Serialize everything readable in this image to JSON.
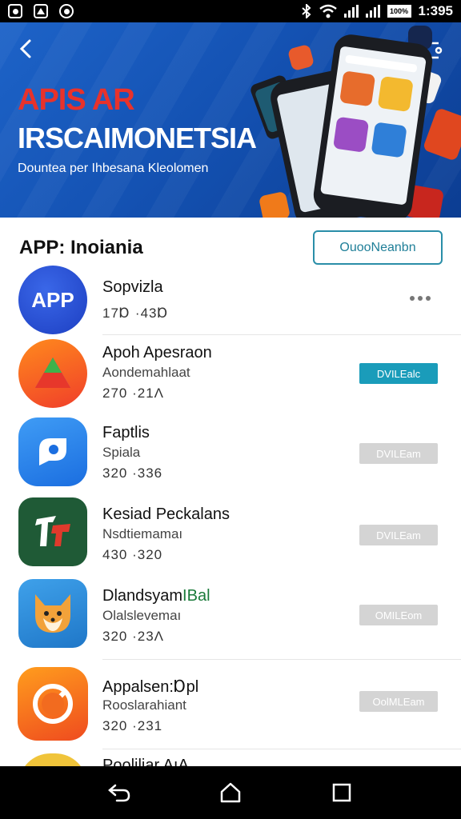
{
  "status_bar": {
    "time": "1:395",
    "battery": "100%"
  },
  "hero": {
    "title_line1": "APIS AR",
    "title_line2": "IRSCAIMONETSIA",
    "subtitle": "Dounteа per Ihbesana Kleolomen"
  },
  "section": {
    "title": "APP: Inoiania",
    "button_label": "OuooNeanbn"
  },
  "apps": [
    {
      "name": "Sopvizla",
      "subtitle": "",
      "meta": "17Ɒ  ·43Ɒ",
      "action": "more"
    },
    {
      "name": "Apoh Apesraon",
      "subtitle": "Aondemahlaat",
      "meta": "270  ·21Ʌ",
      "action": "DVILEalc"
    },
    {
      "name": "Faptlis",
      "subtitle": "Spiala",
      "meta": "320  ·336",
      "action": "DVILEam"
    },
    {
      "name": "Kesiad Peckalans",
      "subtitle": "Nsdtiemamaı",
      "meta": "430  ·320",
      "action": "DVILEam"
    },
    {
      "name": "Dlandsyam",
      "name_accent": "IBal",
      "subtitle": "Olalslevemaı",
      "meta": "320  ·23Ʌ",
      "action": "OMILEom"
    },
    {
      "name": "Appalsen:Ɒpl",
      "subtitle": "Rooslarahiant",
      "meta": "320  ·231",
      "action": "OolMLEam"
    },
    {
      "name": "Pooliliar AıA",
      "subtitle": "",
      "meta": "",
      "action": ""
    }
  ],
  "app_icon_labels": {
    "app1": "APP"
  },
  "colors": {
    "accent": "#1a9cba",
    "hero_red": "#e8322b",
    "hero_blue": "#1452b3"
  },
  "icons": {
    "back": "back-arrow-icon",
    "share": "share-icon",
    "nav_back": "nav-back-icon",
    "nav_home": "nav-home-icon",
    "nav_recents": "nav-recents-icon"
  }
}
